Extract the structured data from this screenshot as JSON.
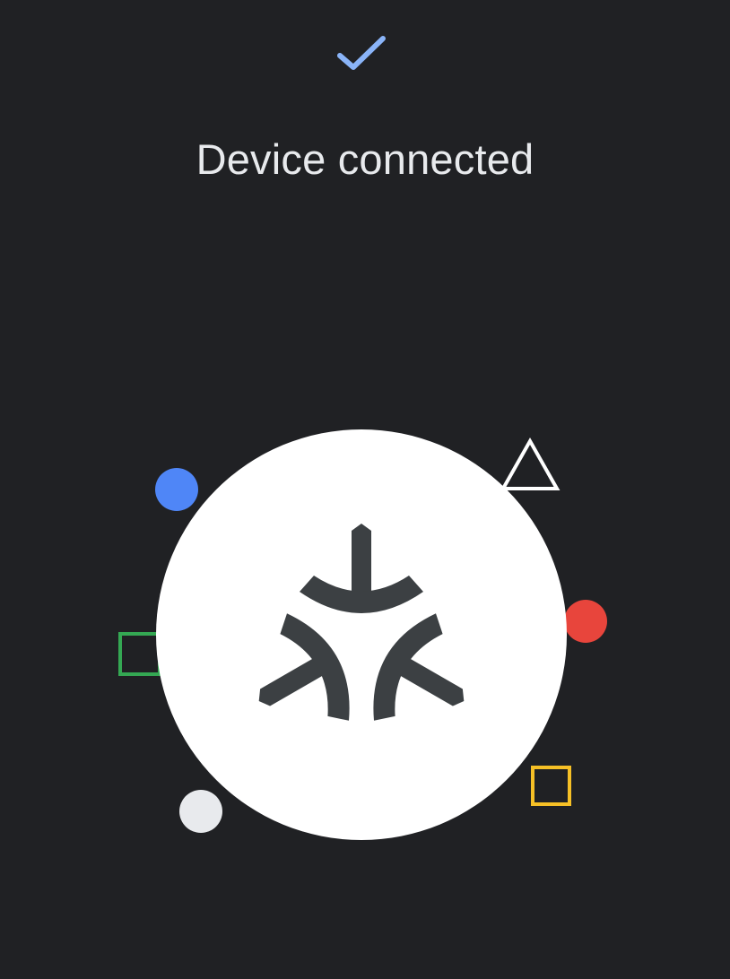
{
  "status": {
    "icon": "checkmark-icon",
    "title": "Device connected"
  },
  "illustration": {
    "center_icon": "matter-logo-icon",
    "decorations": [
      {
        "name": "blue-dot-icon",
        "color": "#4f86f7"
      },
      {
        "name": "white-triangle-icon",
        "color": "#ffffff"
      },
      {
        "name": "red-dot-icon",
        "color": "#e8453c"
      },
      {
        "name": "green-square-icon",
        "color": "#34a853"
      },
      {
        "name": "yellow-square-icon",
        "color": "#f6c026"
      },
      {
        "name": "gray-dot-icon",
        "color": "#e8eaed"
      }
    ]
  },
  "colors": {
    "background": "#202124",
    "accent": "#8ab4f8",
    "logo": "#3c4043"
  }
}
